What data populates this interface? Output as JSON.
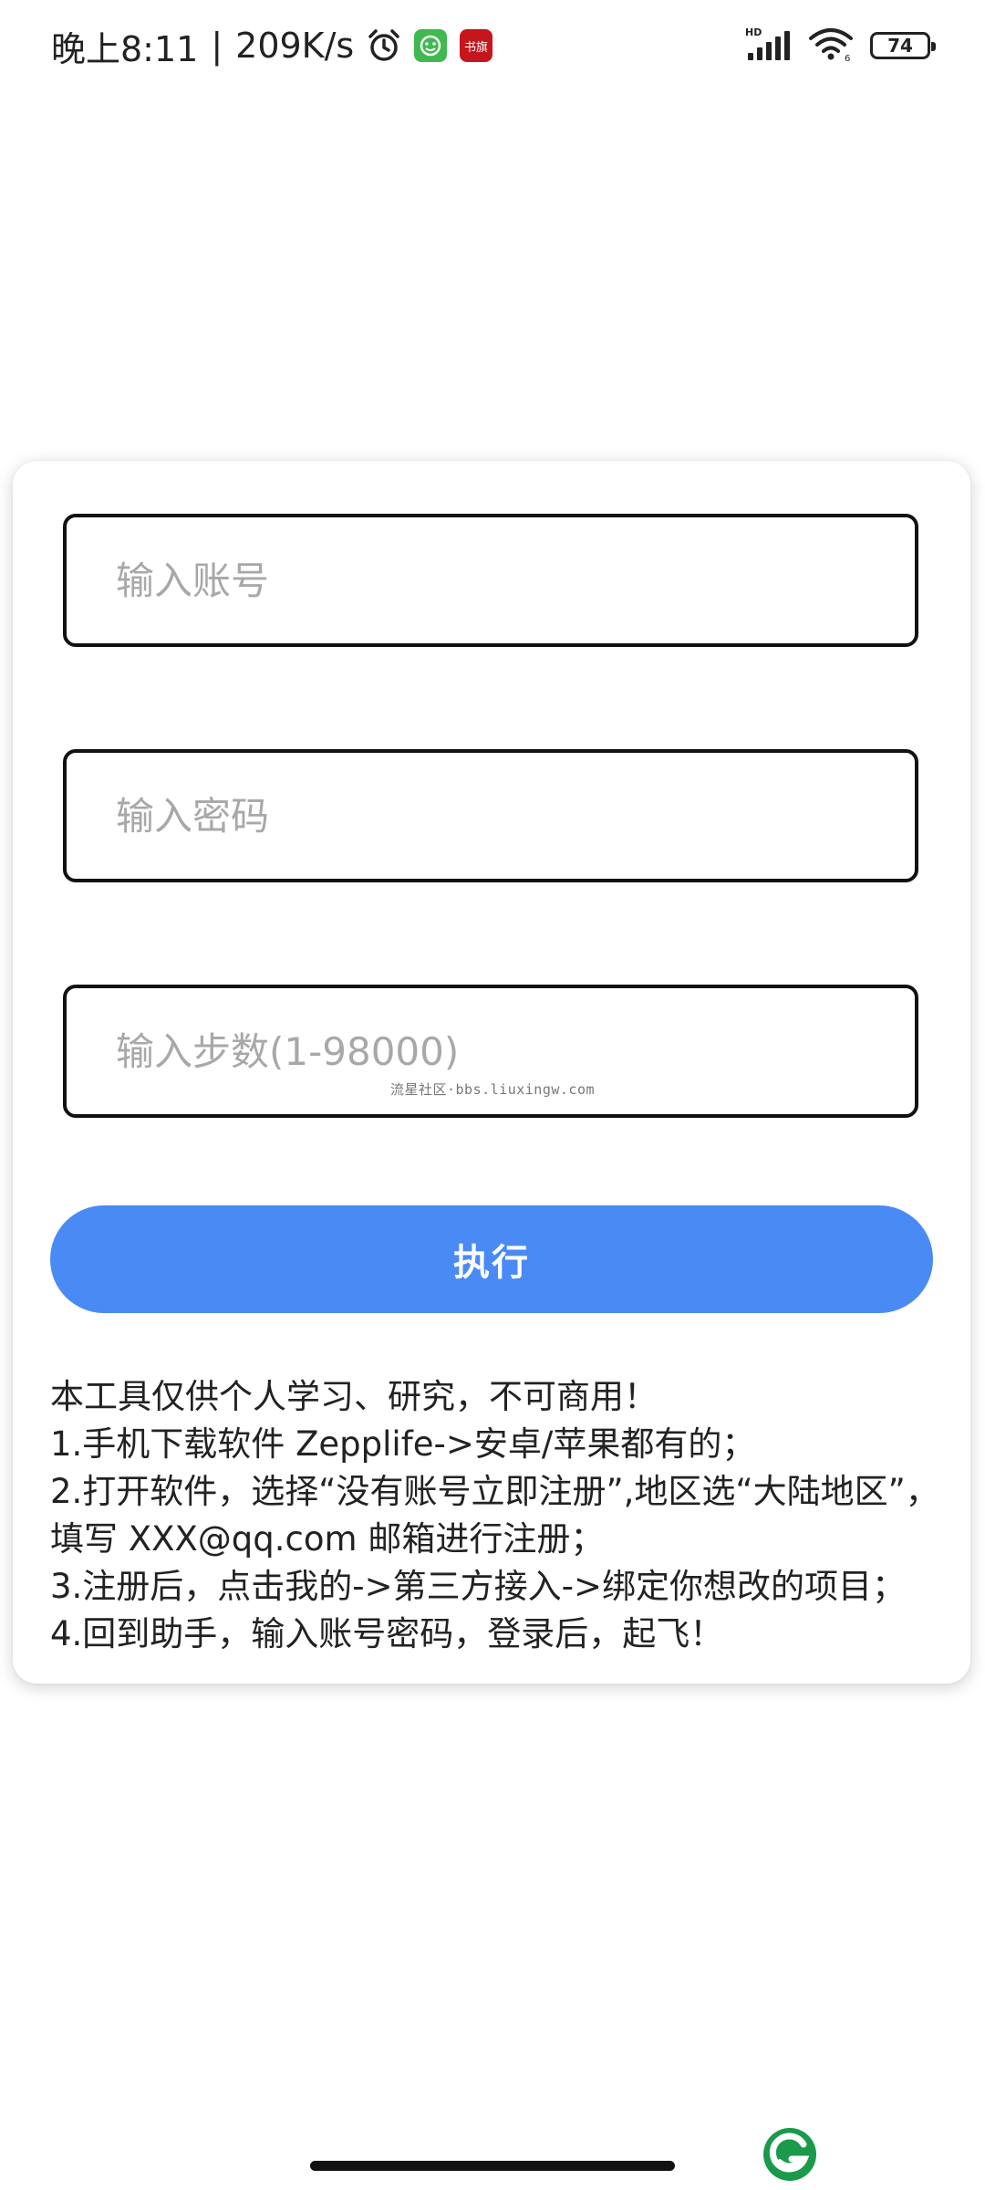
{
  "status_bar": {
    "time": "晚上8:11",
    "net_speed": "209K/s",
    "notif_app_2_label": "书旗",
    "network_label": "HD",
    "battery_level": "74"
  },
  "form": {
    "account_placeholder": "输入账号",
    "password_placeholder": "输入密码",
    "steps_placeholder": "输入步数(1-98000)",
    "watermark": "流星社区·bbs.liuxingw.com",
    "run_button_label": "执行"
  },
  "instructions": {
    "lines": [
      "本工具仅供个人学习、研究，不可商用！",
      "1.手机下载软件 Zepplife->安卓/苹果都有的；",
      "2.打开软件，选择“没有账号立即注册”,地区选“大陆地区”，填写 XXX@qq.com 邮箱进行注册；",
      "3.注册后，点击我的->第三方接入->绑定你想改的项目；",
      "4.回到助手，输入账号密码，登录后，起飞！"
    ]
  },
  "colors": {
    "accent": "#4a8af4",
    "field_border": "#111111",
    "placeholder": "#a8a8a8",
    "logo_green": "#1a9a4a"
  },
  "icons": {
    "alarm": "alarm-clock-icon",
    "app1": "green-app-icon",
    "app2": "red-app-icon",
    "signal": "cell-signal-icon",
    "wifi": "wifi-icon",
    "battery": "battery-icon",
    "floating": "floating-g-logo-icon"
  }
}
